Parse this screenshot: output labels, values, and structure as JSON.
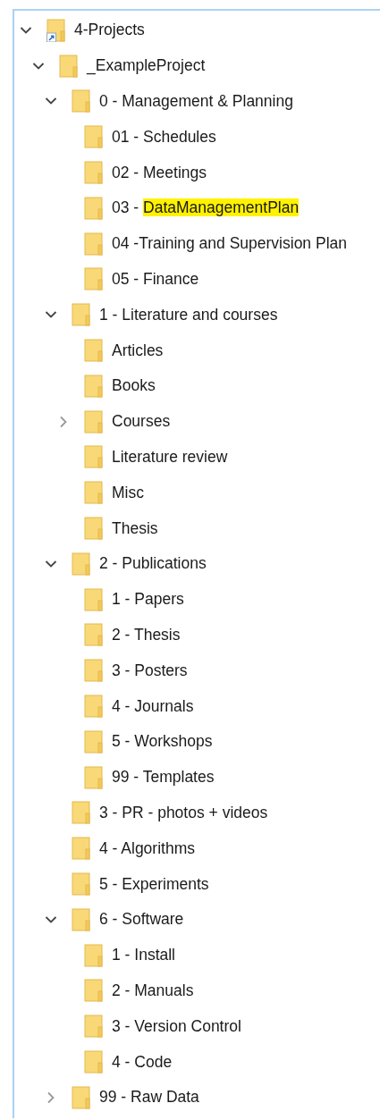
{
  "tree": [
    {
      "label": "4-Projects",
      "shortcut": true,
      "expanded": true,
      "children": [
        {
          "label": "_ExampleProject",
          "expanded": true,
          "children": [
            {
              "label": "0 - Management & Planning",
              "expanded": true,
              "children": [
                {
                  "label": "01 - Schedules"
                },
                {
                  "label": "02 - Meetings"
                },
                {
                  "label_parts": [
                    {
                      "text": "03 - ",
                      "highlighted": false
                    },
                    {
                      "text": "DataManagementPlan",
                      "highlighted": true
                    }
                  ]
                },
                {
                  "label": "04 -Training and Supervision Plan"
                },
                {
                  "label": "05 - Finance"
                }
              ]
            },
            {
              "label": "1 - Literature and courses",
              "expanded": true,
              "children": [
                {
                  "label": "Articles"
                },
                {
                  "label": "Books"
                },
                {
                  "label": "Courses",
                  "expanded": false
                },
                {
                  "label": "Literature review"
                },
                {
                  "label": "Misc"
                },
                {
                  "label": "Thesis"
                }
              ]
            },
            {
              "label": "2 - Publications",
              "expanded": true,
              "children": [
                {
                  "label": "1 - Papers"
                },
                {
                  "label": "2 - Thesis"
                },
                {
                  "label": "3 - Posters"
                },
                {
                  "label": "4 - Journals"
                },
                {
                  "label": "5 - Workshops"
                },
                {
                  "label": "99 - Templates"
                }
              ]
            },
            {
              "label": "3 - PR - photos + videos"
            },
            {
              "label": "4 - Algorithms"
            },
            {
              "label": "5 - Experiments"
            },
            {
              "label": "6 - Software",
              "expanded": true,
              "children": [
                {
                  "label": "1 - Install"
                },
                {
                  "label": "2 - Manuals"
                },
                {
                  "label": "3 - Version Control"
                },
                {
                  "label": "4 - Code"
                }
              ]
            },
            {
              "label": "99 - Raw Data",
              "expanded": false
            }
          ]
        }
      ]
    }
  ]
}
